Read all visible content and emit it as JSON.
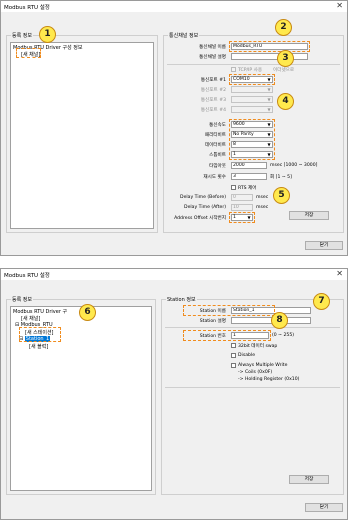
{
  "win1": {
    "title": "Modbus RTU 설정",
    "close_glyph": "✕",
    "registration_group": "등록 정보",
    "tree": {
      "root": "Modbus RTU Driver 구성 정보",
      "new_channel": "[새 채널]"
    },
    "channel_group": "통신채널 정보",
    "fields": {
      "channel_name_label": "통신채널 이름",
      "channel_name_value": "Modbus_RTU",
      "channel_desc_label": "통신채널 설명",
      "channel_desc_value": "",
      "tcp_checkbox_label": "TCP/IP 사용",
      "port_set_label": "이더넷으로",
      "port1_label": "통신포트 #1",
      "port1_value": "COM10",
      "port2_label": "통신포트 #2",
      "port3_label": "통신포트 #3",
      "port4_label": "통신포트 #4",
      "baud_label": "통신속도",
      "baud_value": "9600",
      "parity_label": "패리티비트",
      "parity_value": "No Parity",
      "data_label": "데이터비트",
      "data_value": "8",
      "stop_label": "스톱비트",
      "stop_value": "1",
      "timeout_label": "타임아웃",
      "timeout_value": "2000",
      "timeout_hint": "msec [1000 ~ 3000]",
      "retry_label": "재시도 횟수",
      "retry_value": "3",
      "retry_hint": "회 [1 ~ 5]",
      "rts_label": "RTS 제어",
      "delay_before_label": "Delay Time (Before)",
      "delay_before_value": "0",
      "delay_before_unit": "msec",
      "delay_after_label": "Delay Time (After)",
      "delay_after_value": "10",
      "delay_after_unit": "msec",
      "offset_label": "Address Offset 시작번지",
      "offset_value": "1"
    },
    "save_label": "저장",
    "close_label": "닫기"
  },
  "win2": {
    "title": "Modbus RTU 설정",
    "close_glyph": "✕",
    "registration_group": "등록 정보",
    "tree": {
      "root": "Modbus RTU Driver 구",
      "new_channel": "[새 채널]",
      "channel": "Modbus_RTU",
      "new_station": "[새 스테이션]",
      "station": "Station_1",
      "new_block": "[새 블럭]"
    },
    "station_group": "Station 정보",
    "fields": {
      "station_name_label": "Station 이름",
      "station_name_value": "Station_1",
      "station_desc_label": "Station 설명",
      "station_no_label": "Station 번호",
      "station_no_value": "1",
      "station_no_hint": "(0 ~ 255)",
      "swap_label": "32bit 데이터 swap",
      "disable_label": "Disable",
      "always_multi_label": "Always Multiple Write",
      "coils_line": "-> Coils (0x0F)",
      "holding_line": "-> Holding Register (0x10)"
    },
    "save_label": "저장",
    "close_label": "닫기"
  },
  "badges": [
    "1",
    "2",
    "3",
    "4",
    "5",
    "6",
    "7",
    "8"
  ],
  "colors": {
    "highlight": "#f08c1e",
    "badge_fill": "#ffe94d",
    "selection": "#0078d7"
  }
}
